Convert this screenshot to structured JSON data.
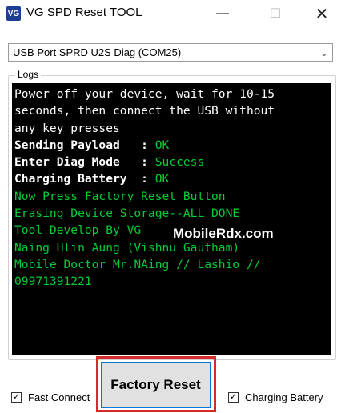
{
  "window": {
    "icon_text": "VG",
    "title": "VG SPD Reset TOOL",
    "minimize_glyph": "—",
    "maximize_glyph": "☐",
    "close_glyph": "✕"
  },
  "port": {
    "selected": "USB Port SPRD U2S Diag (COM25)",
    "chevron": "⌄"
  },
  "logs": {
    "label": "Logs",
    "lines": [
      {
        "text": "Power off your device, wait for 10-15",
        "color": "white"
      },
      {
        "text": "seconds, then connect the USB without",
        "color": "white"
      },
      {
        "text": "any key presses",
        "color": "white"
      },
      {
        "label": "Sending Payload   : ",
        "value": "OK"
      },
      {
        "label": "Enter Diag Mode   : ",
        "value": "Success"
      },
      {
        "label": "Charging Battery  : ",
        "value": "OK"
      },
      {
        "text": "Now Press Factory Reset Button",
        "color": "green"
      },
      {
        "text": "Erasing Device Storage--ALL DONE",
        "color": "green"
      },
      {
        "text": "Tool Develop By VG",
        "color": "green"
      },
      {
        "text": "Naing Hlin Aung (Vishnu Gautham)",
        "color": "green"
      },
      {
        "text": "Mobile Doctor Mr.NAing // Lashio //",
        "color": "green"
      },
      {
        "text": "09971391221",
        "color": "green"
      }
    ],
    "watermark": "MobileRdx.com"
  },
  "options": {
    "fast_connect": {
      "label": "Fast Connect",
      "checked": true
    },
    "charging_battery": {
      "label": "Charging Battery",
      "checked": true
    }
  },
  "actions": {
    "factory_reset_label": "Factory Reset"
  },
  "colors": {
    "console_bg": "#000000",
    "console_text": "#ffffff",
    "console_green": "#00cc33",
    "highlight": "#d52b2b",
    "button_focus": "#0078d7"
  }
}
